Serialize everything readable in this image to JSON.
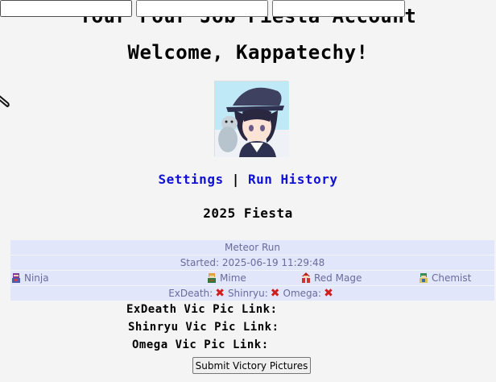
{
  "header": {
    "title": "Your Four Job Fiesta Account",
    "welcome": "Welcome, Kappatechy!"
  },
  "nav": {
    "settings": "Settings",
    "separator": "|",
    "run_history": "Run History"
  },
  "fiesta_label": "2025 Fiesta",
  "run": {
    "name": "Meteor Run",
    "started": "Started: 2025-06-19 11:29:48",
    "jobs": [
      "Ninja",
      "Mime",
      "Red Mage",
      "Chemist"
    ],
    "bosses": [
      {
        "label": "ExDeath:",
        "status_icon": "x-icon"
      },
      {
        "label": "Shinryu:",
        "status_icon": "x-icon"
      },
      {
        "label": "Omega:",
        "status_icon": "x-icon"
      }
    ]
  },
  "form": {
    "exdeath_label": "ExDeath Vic Pic Link:",
    "exdeath_value": "",
    "shinryu_label": "Shinryu Vic Pic Link:",
    "shinryu_value": "",
    "omega_label": "Omega Vic Pic Link:",
    "omega_value": "",
    "submit_label": "Submit Victory Pictures"
  },
  "colors": {
    "background": "#f4f4f4",
    "link": "#1010d8",
    "row_bg": "#e2e6fb",
    "row_text": "#6a6a9c",
    "fail": "#d21d1d"
  }
}
